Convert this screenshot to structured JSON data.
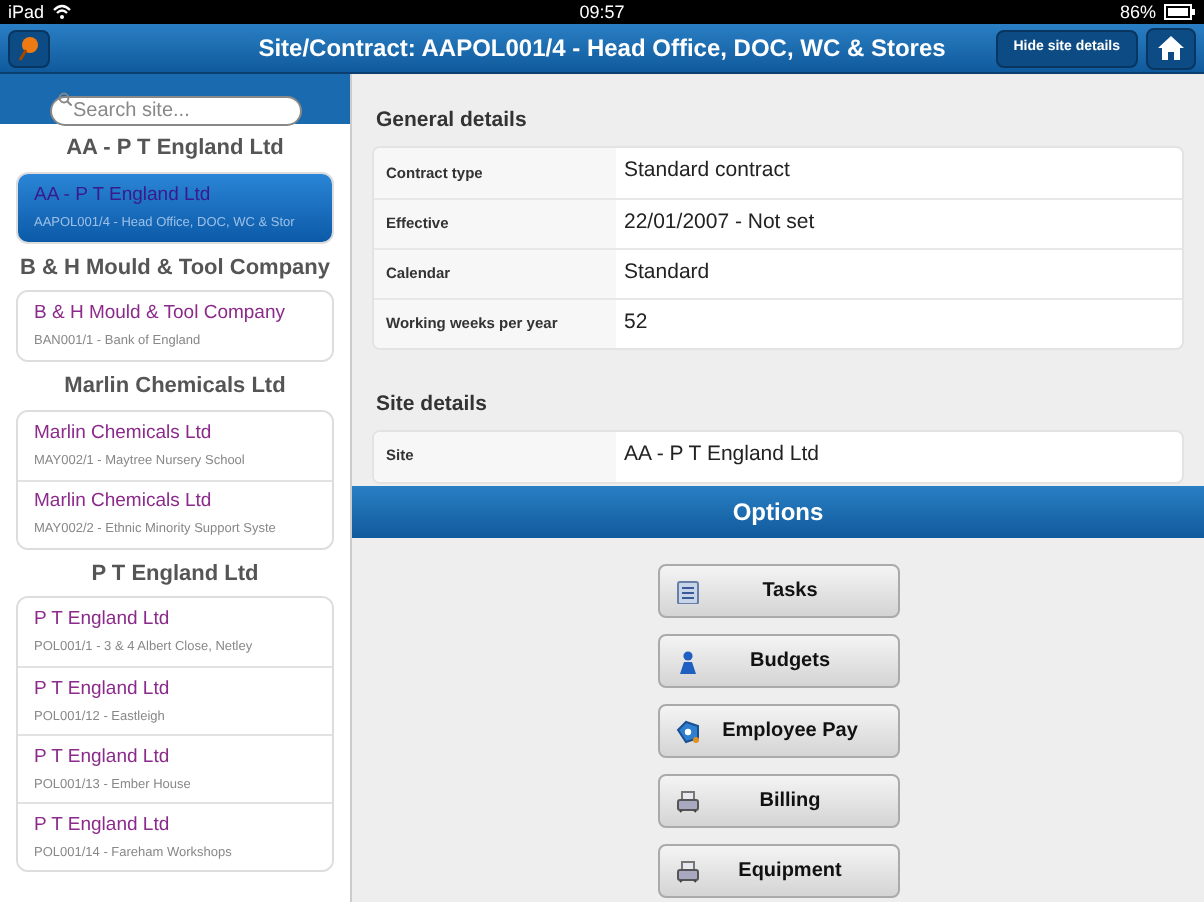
{
  "status_bar": {
    "device": "iPad",
    "time": "09:57",
    "battery": "86%"
  },
  "header": {
    "title": "Site/Contract: AAPOL001/4 - Head Office, DOC, WC & Stores",
    "hide_button": "Hide site details"
  },
  "search": {
    "placeholder": "Search site..."
  },
  "sidebar": {
    "groups": [
      {
        "heading": "AA - P T England Ltd",
        "items": [
          {
            "title": "AA - P T England Ltd",
            "subtitle": "AAPOL001/4 - Head Office, DOC, WC & Stor",
            "selected": true
          }
        ]
      },
      {
        "heading": "B & H Mould & Tool Company",
        "items": [
          {
            "title": "B & H Mould & Tool Company",
            "subtitle": "BAN001/1 - Bank of England",
            "selected": false
          }
        ]
      },
      {
        "heading": "Marlin Chemicals Ltd",
        "items": [
          {
            "title": "Marlin Chemicals Ltd",
            "subtitle": "MAY002/1 - Maytree Nursery School",
            "selected": false
          },
          {
            "title": "Marlin Chemicals Ltd",
            "subtitle": "MAY002/2 - Ethnic Minority Support Syste",
            "selected": false
          }
        ]
      },
      {
        "heading": "P T England Ltd",
        "items": [
          {
            "title": "P T England Ltd",
            "subtitle": "POL001/1 - 3 & 4 Albert Close, Netley",
            "selected": false
          },
          {
            "title": "P T England Ltd",
            "subtitle": "POL001/12 - Eastleigh",
            "selected": false
          },
          {
            "title": "P T England Ltd",
            "subtitle": "POL001/13 - Ember House",
            "selected": false
          },
          {
            "title": "P T England Ltd",
            "subtitle": "POL001/14 - Fareham Workshops",
            "selected": false
          }
        ]
      }
    ]
  },
  "sections": [
    {
      "heading": "General details",
      "rows": [
        {
          "label": "Contract type",
          "value": "Standard contract"
        },
        {
          "label": "Effective",
          "value": "22/01/2007 - Not set"
        },
        {
          "label": "Calendar",
          "value": "Standard"
        },
        {
          "label": "Working weeks per year",
          "value": "52"
        }
      ]
    },
    {
      "heading": "Site details",
      "rows": [
        {
          "label": "Site",
          "value": "AA - P T England Ltd"
        }
      ]
    }
  ],
  "options": {
    "title": "Options",
    "buttons": [
      {
        "label": "Tasks",
        "kind": "list"
      },
      {
        "label": "Budgets",
        "kind": "pawn"
      },
      {
        "label": "Employee Pay",
        "kind": "tag"
      },
      {
        "label": "Billing",
        "kind": "printer"
      },
      {
        "label": "Equipment",
        "kind": "printer"
      }
    ]
  }
}
